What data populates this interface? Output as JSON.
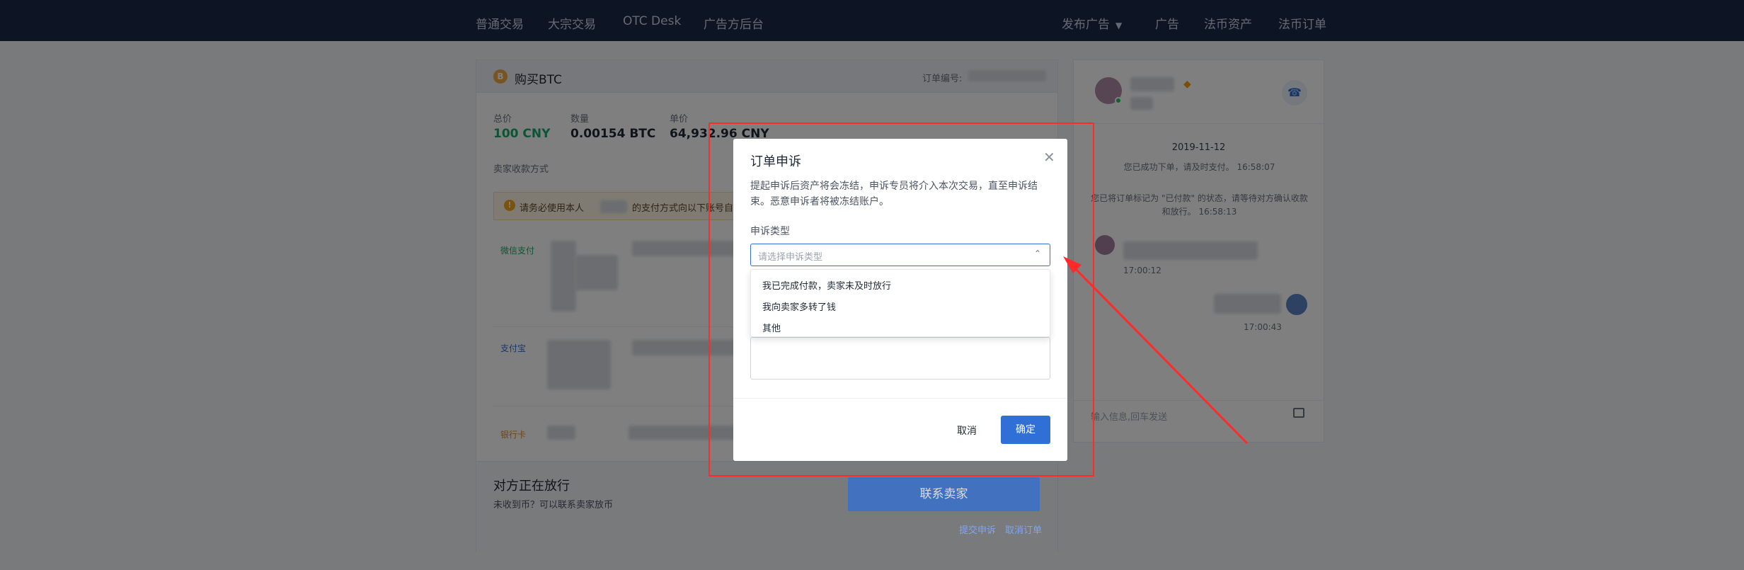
{
  "nav": {
    "left": [
      "普通交易",
      "大宗交易",
      "OTC Desk",
      "广告方后台"
    ],
    "right": [
      "发布广告",
      "广告",
      "法币资产",
      "法币订单"
    ]
  },
  "order": {
    "coin_letter": "B",
    "title": "购买BTC",
    "order_no_label": "订单编号:",
    "total_label": "总价",
    "total_value": "100 CNY",
    "qty_label": "数量",
    "qty_value": "0.00154 BTC",
    "price_label": "单价",
    "price_value": "64,932.96 CNY",
    "pay_section_label": "卖家收款方式",
    "warning_prefix": "请务必使用本人",
    "warning_suffix": "的支付方式向以下账号自行转账",
    "pay_methods": [
      "微信支付",
      "支付宝",
      "银行卡"
    ],
    "status_title": "对方正在放行",
    "status_sub": "未收到币？可以联系卖家放币",
    "contact_button": "联系卖家",
    "appeal_link": "提交申诉",
    "cancel_link": "取消订单"
  },
  "chat": {
    "date": "2019-11-12",
    "sys_msg_1": "您已成功下单，请及时支付。 16:58:07",
    "sys_msg_2": "您已将订单标记为 \"已付款\" 的状态，请等待对方确认收款和放行。 16:58:13",
    "time_1": "17:00:12",
    "time_2": "17:00:43",
    "input_placeholder": "输入信息,回车发送"
  },
  "modal": {
    "title": "订单申诉",
    "description": "提起申诉后资产将会冻结，申诉专员将介入本次交易，直至申诉结束。恶意申诉者将被冻结账户。",
    "field_label": "申诉类型",
    "select_placeholder": "请选择申诉类型",
    "options": [
      "我已完成付款，卖家未及时放行",
      "我向卖家多转了钱",
      "其他"
    ],
    "cancel_label": "取消",
    "confirm_label": "确定"
  },
  "colors": {
    "nav_bg": "#1b2b4b",
    "primary": "#2f6fd6",
    "green": "#1aa96d",
    "annotation": "#ff2a2a"
  }
}
